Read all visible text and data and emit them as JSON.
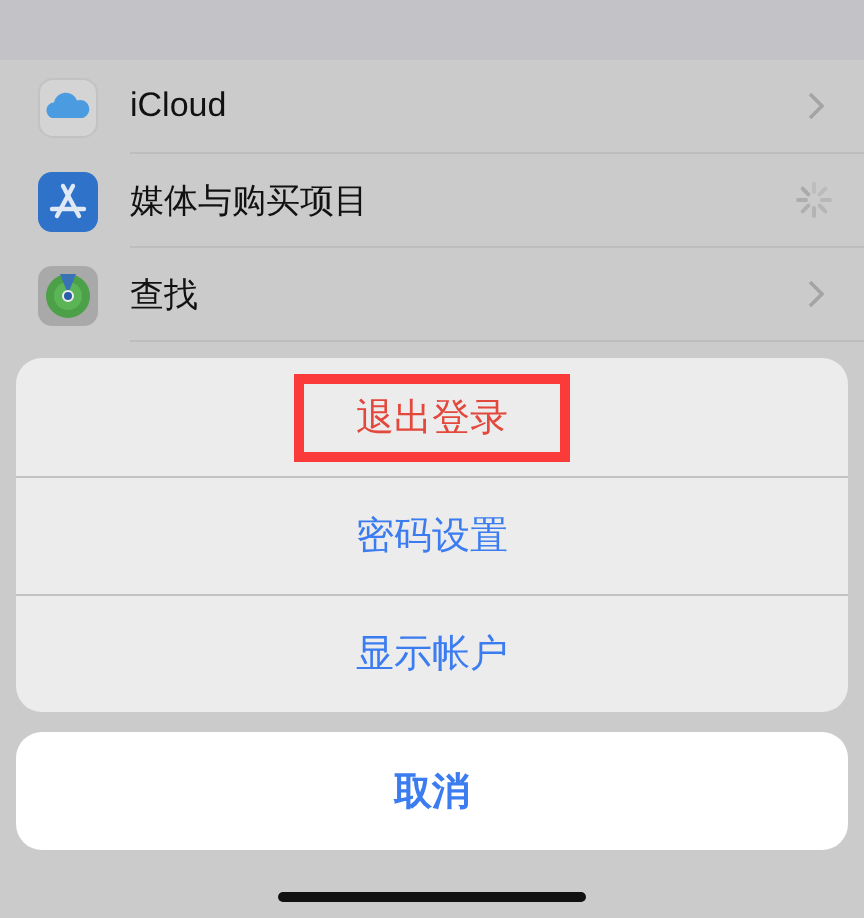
{
  "settings_rows": [
    {
      "label": "iCloud",
      "loading": false
    },
    {
      "label": "媒体与购买项目",
      "loading": true
    },
    {
      "label": "查找",
      "loading": false
    }
  ],
  "action_sheet": {
    "actions": [
      {
        "label": "退出登录",
        "destructive": true,
        "highlighted": true
      },
      {
        "label": "密码设置",
        "destructive": false,
        "highlighted": false
      },
      {
        "label": "显示帐户",
        "destructive": false,
        "highlighted": false
      }
    ],
    "cancel": "取消"
  }
}
